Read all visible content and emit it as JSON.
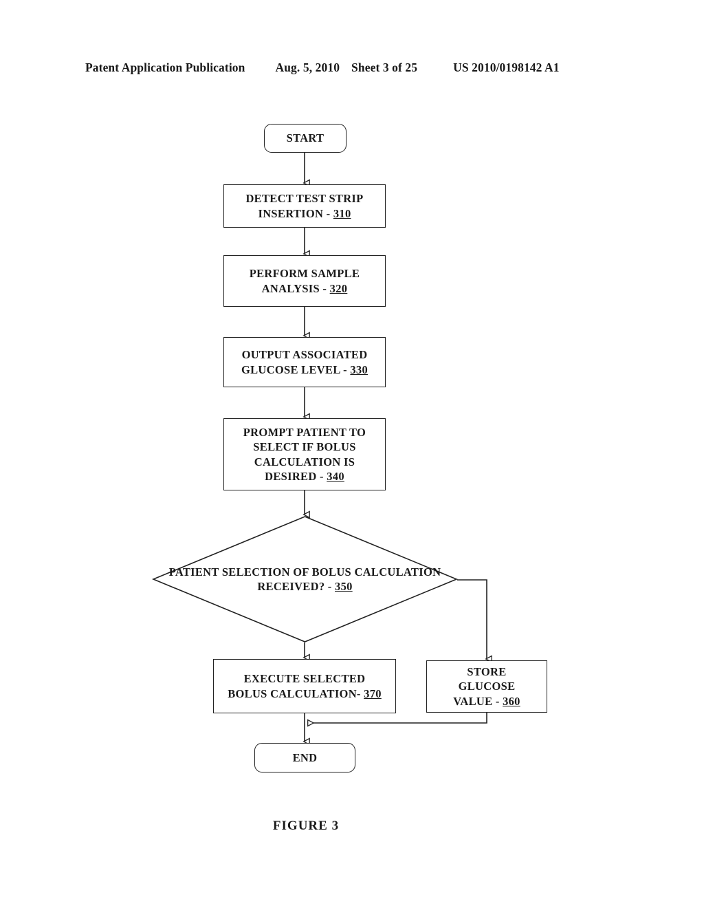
{
  "header": {
    "publication": "Patent Application Publication",
    "date": "Aug. 5, 2010",
    "sheet": "Sheet 3 of 25",
    "number": "US 2010/0198142 A1"
  },
  "figure": {
    "caption": "FIGURE 3"
  },
  "flow": {
    "start": {
      "label": "START"
    },
    "step_310": {
      "line1": "DETECT TEST STRIP",
      "line2_text": "INSERTION - ",
      "ref": "310"
    },
    "step_320": {
      "line1": "PERFORM SAMPLE",
      "line2_text": "ANALYSIS - ",
      "ref": "320"
    },
    "step_330": {
      "line1": "OUTPUT ASSOCIATED",
      "line2_text": "GLUCOSE LEVEL - ",
      "ref": "330"
    },
    "step_340": {
      "line1": "PROMPT PATIENT TO",
      "line2": "SELECT IF BOLUS",
      "line3": "CALCULATION IS",
      "line4_text": "DESIRED - ",
      "ref": "340"
    },
    "decision_350": {
      "line1": "PATIENT SELECTION",
      "line2": "OF BOLUS",
      "line3": "CALCULATION",
      "line4_text": "RECEIVED? - ",
      "ref": "350"
    },
    "step_360": {
      "line1": "STORE",
      "line2": "GLUCOSE",
      "line3_text": "VALUE - ",
      "ref": "360"
    },
    "step_370": {
      "line1": "EXECUTE SELECTED",
      "line2_text": "BOLUS CALCULATION- ",
      "ref": "370"
    },
    "end": {
      "label": "END"
    }
  },
  "colors": {
    "line": "#222222",
    "background": "#ffffff",
    "text": "#1a1a1a"
  }
}
